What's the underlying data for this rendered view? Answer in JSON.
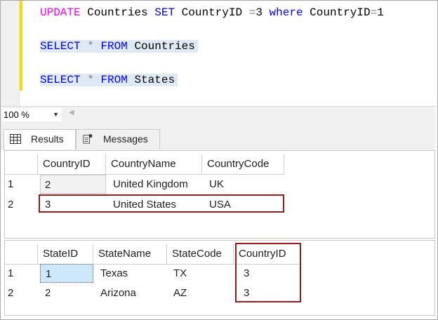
{
  "editor": {
    "line1": [
      "UPDATE",
      "Countries",
      "SET",
      "CountryID",
      "=",
      "3",
      "where",
      "CountryID",
      "=",
      "1"
    ],
    "line2": [
      "SELECT",
      "*",
      "FROM",
      "Countries"
    ],
    "line3": [
      "SELECT",
      "*",
      "FROM",
      "States"
    ]
  },
  "zoom": {
    "value": "100 %"
  },
  "tabs": [
    {
      "label": "Results",
      "icon": "grid-icon"
    },
    {
      "label": "Messages",
      "icon": "messages-icon"
    }
  ],
  "grid1": {
    "columns": [
      "CountryID",
      "CountryName",
      "CountryCode"
    ],
    "rows": [
      {
        "num": "1",
        "cells": [
          "2",
          "United Kingdom",
          "UK"
        ]
      },
      {
        "num": "2",
        "cells": [
          "3",
          "United States",
          "USA"
        ]
      }
    ]
  },
  "grid2": {
    "columns": [
      "StateID",
      "StateName",
      "StateCode",
      "CountryID"
    ],
    "rows": [
      {
        "num": "1",
        "cells": [
          "1",
          "Texas",
          "TX",
          "3"
        ]
      },
      {
        "num": "2",
        "cells": [
          "2",
          "Arizona",
          "AZ",
          "3"
        ]
      }
    ]
  },
  "colors": {
    "highlight": "#9a1b1b",
    "keyword": "#0000ff",
    "function": "#ff00ff",
    "selected_cell": "#cde8fb"
  }
}
